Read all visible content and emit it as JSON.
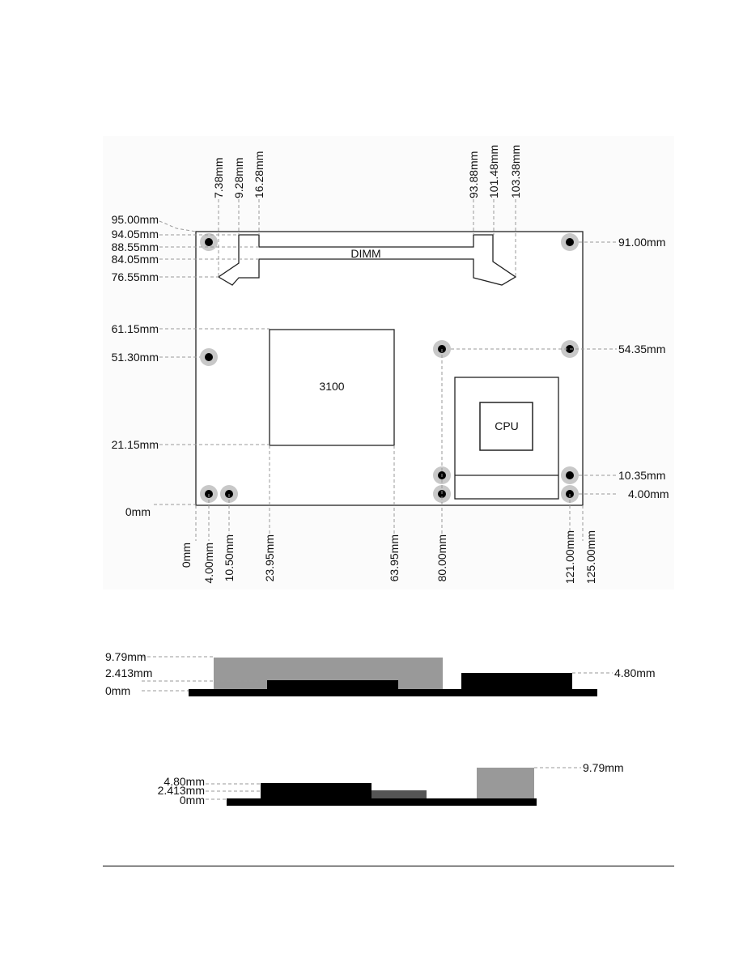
{
  "top_view": {
    "top_labels": [
      "7.38mm",
      "9.28mm",
      "16.28mm",
      "93.88mm",
      "101.48mm",
      "103.38mm"
    ],
    "left_labels": [
      "95.00mm",
      "94.05mm",
      "88.55mm",
      "84.05mm",
      "76.55mm",
      "61.15mm",
      "51.30mm",
      "21.15mm",
      "0mm"
    ],
    "right_labels": [
      "91.00mm",
      "54.35mm",
      "10.35mm",
      "4.00mm"
    ],
    "bottom_labels": [
      "0mm",
      "4.00mm",
      "10.50mm",
      "23.95mm",
      "63.95mm",
      "80.00mm",
      "121.00mm",
      "125.00mm"
    ],
    "components": {
      "dimm": "DIMM",
      "chipset": "3100",
      "cpu": "CPU"
    }
  },
  "side_view_1": {
    "left_labels": [
      "9.79mm",
      "2.413mm",
      "0mm"
    ],
    "right_labels": [
      "4.80mm"
    ]
  },
  "side_view_2": {
    "left_labels": [
      "4.80mm",
      "2.413mm",
      "0mm"
    ],
    "right_labels": [
      "9.79mm"
    ]
  },
  "colors": {
    "pcb": "#000000",
    "heatsink": "#999999",
    "chip": "#555555",
    "mount_hole_ring": "#c8c8c8"
  }
}
